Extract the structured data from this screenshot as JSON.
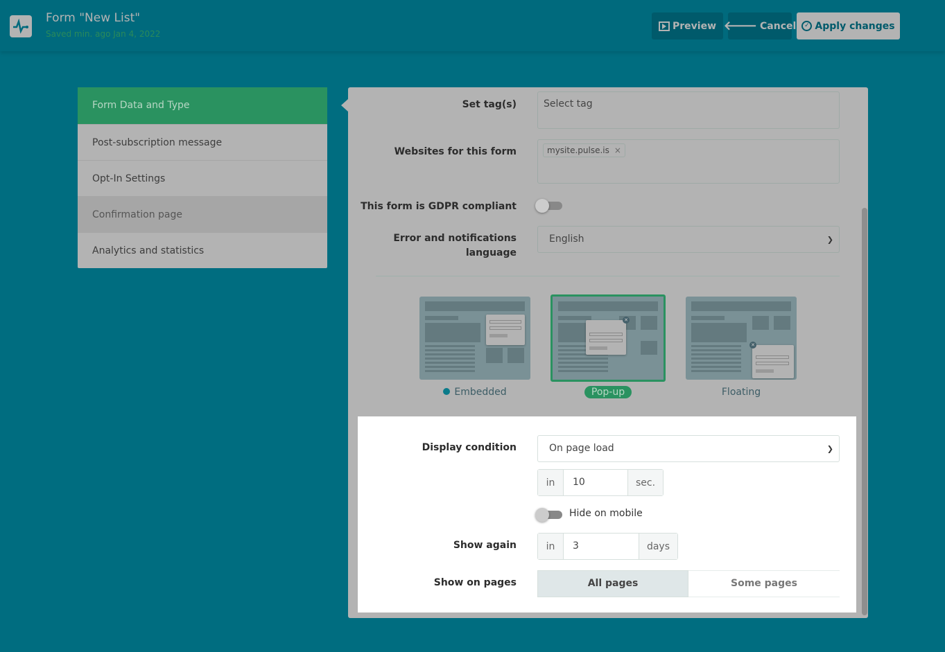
{
  "header": {
    "title": "Form \"New List\"",
    "saved": "Saved min. ago Jan 4, 2022",
    "preview": "Preview",
    "cancel": "Cancel",
    "apply": "Apply changes"
  },
  "sidebar": {
    "items": [
      {
        "label": "Form Data and Type"
      },
      {
        "label": "Post-subscription message"
      },
      {
        "label": "Opt-In Settings"
      },
      {
        "label": "Confirmation page"
      },
      {
        "label": "Analytics and statistics"
      }
    ]
  },
  "form": {
    "tags_label": "Set tag(s)",
    "tags_placeholder": "Select tag",
    "websites_label": "Websites for this form",
    "website_chip": "mysite.pulse.is",
    "chip_remove": "×",
    "gdpr_label": "This form is GDPR compliant",
    "lang_label_1": "Error and notifications",
    "lang_label_2": "language",
    "lang_value": "English",
    "types": [
      {
        "label": "Embedded"
      },
      {
        "label": "Pop-up"
      },
      {
        "label": "Floating"
      }
    ],
    "display_label": "Display condition",
    "display_value": "On page load",
    "delay_in": "in",
    "delay_value": "10",
    "delay_unit": "sec.",
    "hide_mobile": "Hide on mobile",
    "show_again_label": "Show again",
    "again_in": "in",
    "again_value": "3",
    "again_unit": "days",
    "pages_label": "Show on pages",
    "pages_all": "All pages",
    "pages_some": "Some pages"
  },
  "colors": {
    "bg": "#006d80",
    "accent": "#2a9260"
  }
}
